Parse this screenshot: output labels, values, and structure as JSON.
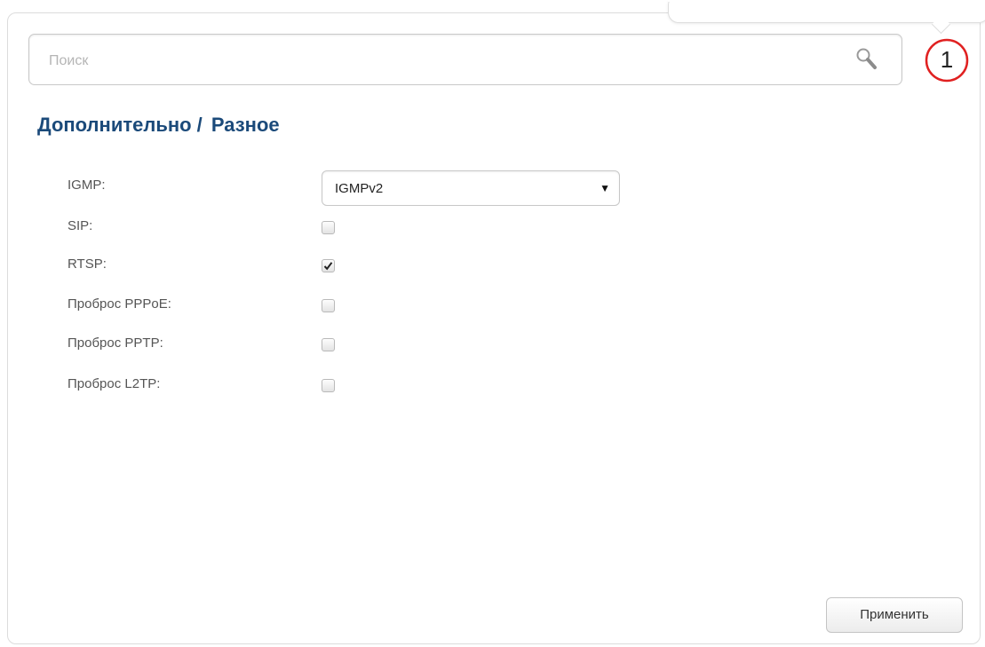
{
  "search": {
    "placeholder": "Поиск",
    "value": "",
    "icon": "search-icon"
  },
  "notifications": {
    "count": "1",
    "color": "#e02020"
  },
  "breadcrumb": {
    "section": "Дополнительно",
    "separator": "/",
    "page": "Разное",
    "color": "#1b4a7a"
  },
  "form": {
    "igmp": {
      "label": "IGMP:",
      "selected": "IGMPv2"
    },
    "sip": {
      "label": "SIP:",
      "checked": false
    },
    "rtsp": {
      "label": "RTSP:",
      "checked": true
    },
    "pppoe": {
      "label": "Проброс PPPoE:",
      "checked": false
    },
    "pptp": {
      "label": "Проброс PPTP:",
      "checked": false
    },
    "l2tp": {
      "label": "Проброс L2TP:",
      "checked": false
    }
  },
  "actions": {
    "apply_label": "Применить"
  }
}
